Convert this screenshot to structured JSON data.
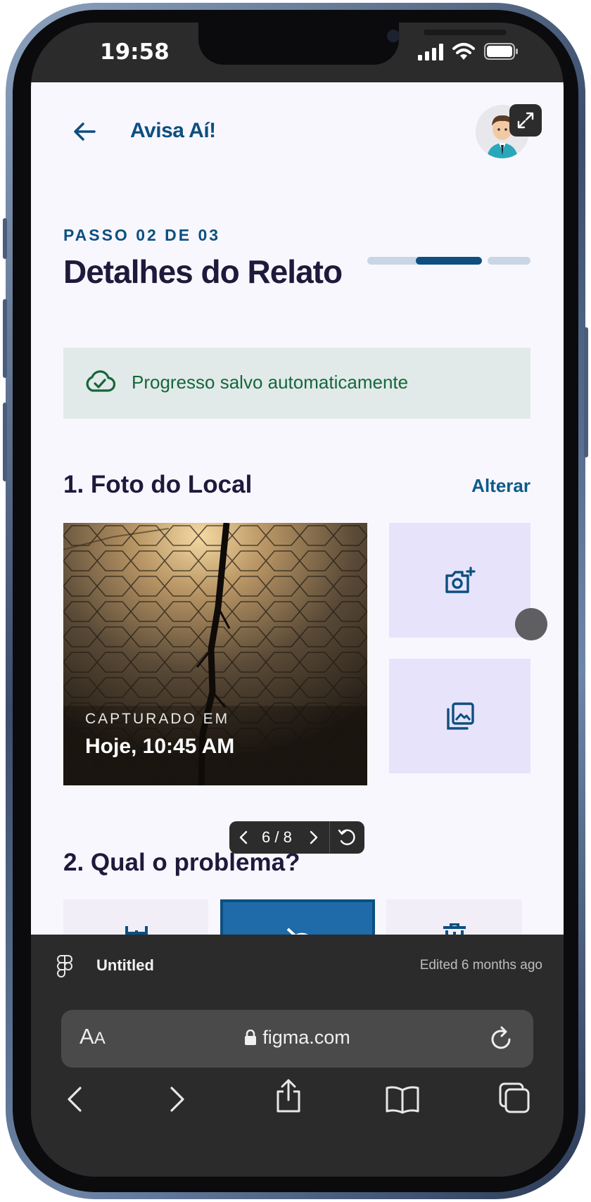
{
  "status": {
    "time": "19:58"
  },
  "header": {
    "title": "Avisa Aí!"
  },
  "step": {
    "label": "PASSO 02 DE 03",
    "title": "Detalhes do Relato",
    "current": 2,
    "total": 3
  },
  "banner": {
    "text": "Progresso salvo automaticamente"
  },
  "photo_section": {
    "title": "1. Foto do Local",
    "action": "Alterar",
    "caption_label": "CAPTURADO EM",
    "caption_value": "Hoje, 10:45 AM"
  },
  "problem_section": {
    "title": "2. Qual o problema?"
  },
  "pager": {
    "text": "6 / 8"
  },
  "figma": {
    "file_name": "Untitled",
    "edited": "Edited 6 months ago"
  },
  "browser": {
    "aa_label": "A",
    "aa_small": "A",
    "url": "figma.com"
  },
  "colors": {
    "brand": "#0d4f80",
    "title": "#1e1a3c",
    "success": "#17663b",
    "tile": "#e7e3fb",
    "selected_category": "#1f6aa8"
  }
}
